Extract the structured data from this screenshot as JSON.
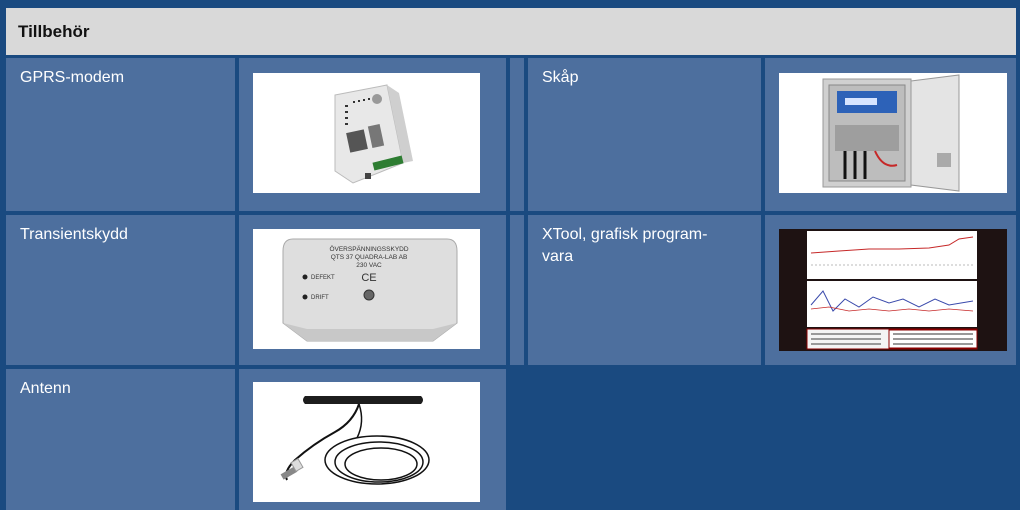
{
  "header": {
    "title": "Tillbehör"
  },
  "items": [
    {
      "label": "GPRS-modem",
      "image_icon": "gprs-modem-image"
    },
    {
      "label": "Skåp",
      "image_icon": "cabinet-image"
    },
    {
      "label": "Transientskydd",
      "image_icon": "transient-protection-image"
    },
    {
      "label": "XTool, grafisk program-vara",
      "label_lines": [
        "XTool, grafisk program-",
        "vara"
      ],
      "image_icon": "xtool-screenshot-image"
    },
    {
      "label": "Antenn",
      "image_icon": "antenna-image"
    }
  ],
  "transient": {
    "line1": "ÖVERSPÄNNINGSSKYDD",
    "line2": "QTS 37 QUADRA-LAB AB",
    "line3": "230 VAC",
    "ce": "CE",
    "defekt": "DEFEKT",
    "drift": "DRIFT"
  },
  "colors": {
    "background": "#1a4a80",
    "cell": "#4d6f9e",
    "header": "#d9d9d9"
  }
}
